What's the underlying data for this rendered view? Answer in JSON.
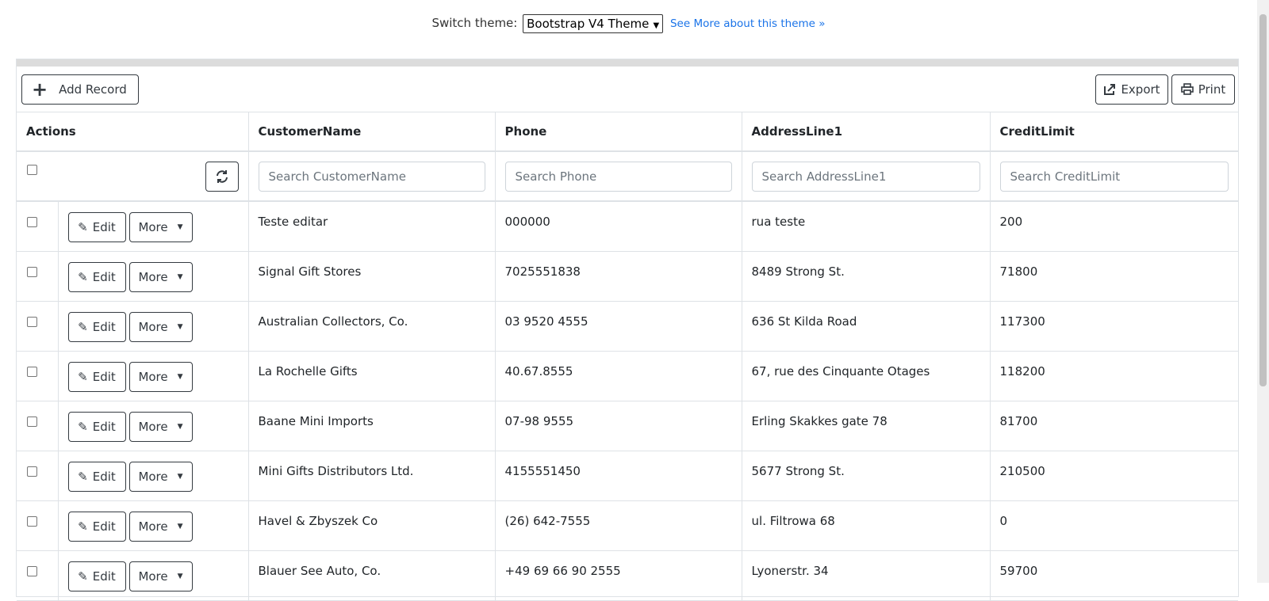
{
  "topbar": {
    "label": "Switch theme:",
    "selected_theme": "Bootstrap V4 Theme",
    "link": "See More about this theme »"
  },
  "toolbar": {
    "add_label": "Add Record",
    "export_label": "Export",
    "print_label": "Print"
  },
  "columns": {
    "actions": "Actions",
    "customer_name": "CustomerName",
    "phone": "Phone",
    "address": "AddressLine1",
    "credit": "CreditLimit"
  },
  "filters": {
    "customer_name": "Search CustomerName",
    "phone": "Search Phone",
    "address": "Search AddressLine1",
    "credit": "Search CreditLimit"
  },
  "row_buttons": {
    "edit": "Edit",
    "more": "More"
  },
  "rows": [
    {
      "name": "Teste editar",
      "phone": "000000",
      "address": "rua teste",
      "credit": "200"
    },
    {
      "name": "Signal Gift Stores",
      "phone": "7025551838",
      "address": "8489 Strong St.",
      "credit": "71800"
    },
    {
      "name": "Australian Collectors, Co.",
      "phone": "03 9520 4555",
      "address": "636 St Kilda Road",
      "credit": "117300"
    },
    {
      "name": "La Rochelle Gifts",
      "phone": "40.67.8555",
      "address": "67, rue des Cinquante Otages",
      "credit": "118200"
    },
    {
      "name": "Baane Mini Imports",
      "phone": "07-98 9555",
      "address": "Erling Skakkes gate 78",
      "credit": "81700"
    },
    {
      "name": "Mini Gifts Distributors Ltd.",
      "phone": "4155551450",
      "address": "5677 Strong St.",
      "credit": "210500"
    },
    {
      "name": "Havel & Zbyszek Co",
      "phone": "(26) 642-7555",
      "address": "ul. Filtrowa 68",
      "credit": "0"
    },
    {
      "name": "Blauer See Auto, Co.",
      "phone": "+49 69 66 90 2555",
      "address": "Lyonerstr. 34",
      "credit": "59700"
    }
  ]
}
